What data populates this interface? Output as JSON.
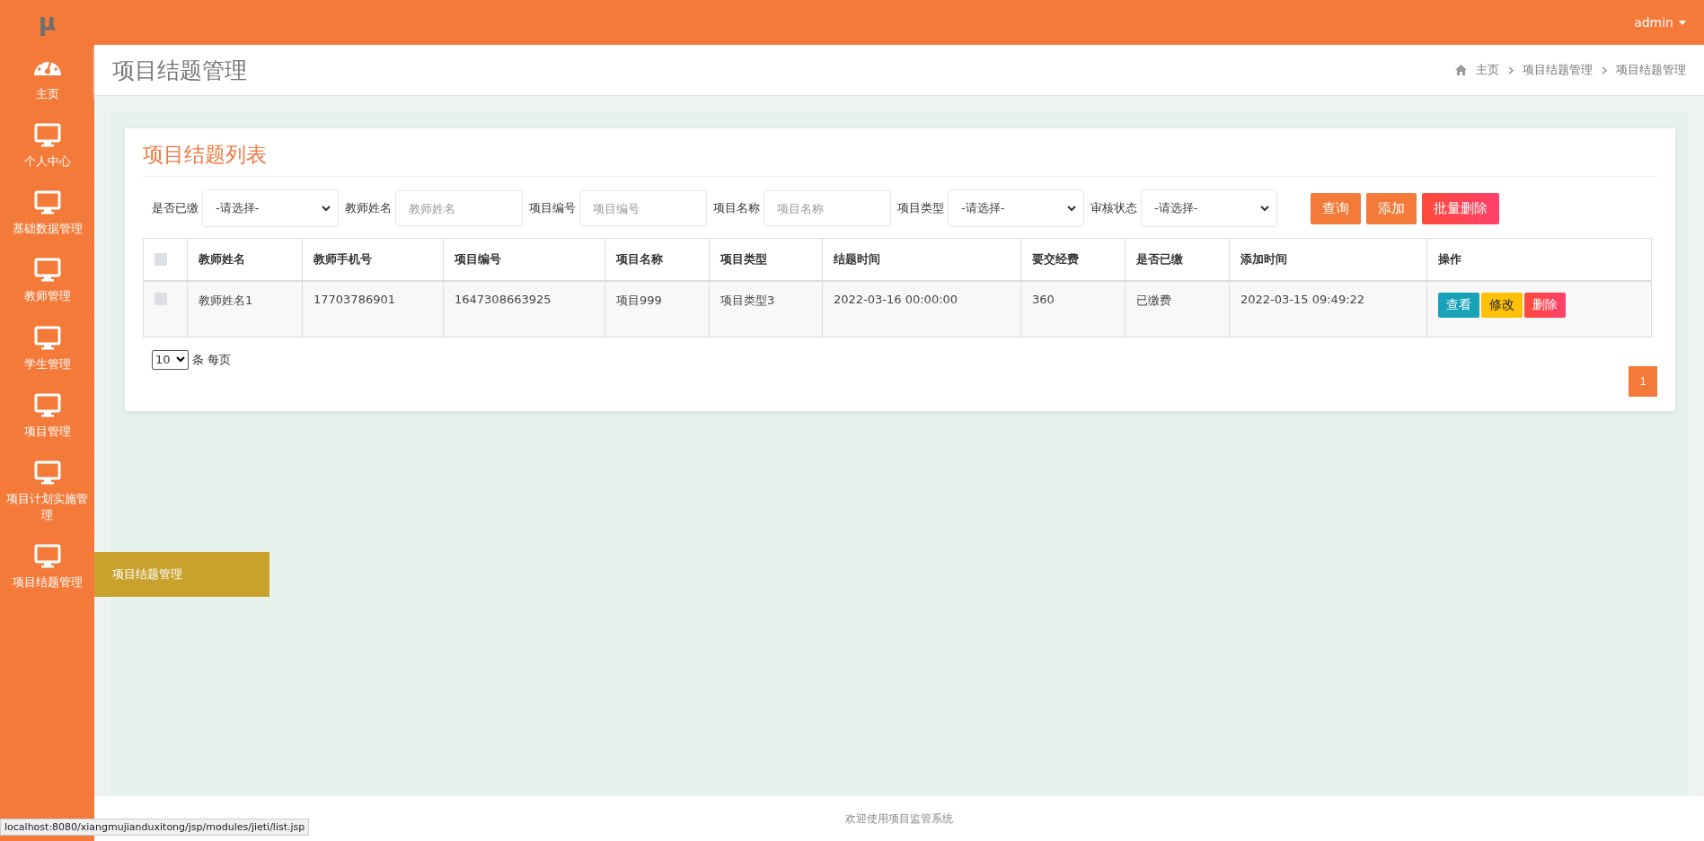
{
  "topbar": {
    "logo": "μ",
    "user": "admin"
  },
  "sidebar": {
    "items": [
      {
        "label": "主页",
        "kind": "gauge"
      },
      {
        "label": "个人中心",
        "kind": "monitor"
      },
      {
        "label": "基础数据管理",
        "kind": "monitor"
      },
      {
        "label": "教师管理",
        "kind": "monitor"
      },
      {
        "label": "学生管理",
        "kind": "monitor"
      },
      {
        "label": "项目管理",
        "kind": "monitor"
      },
      {
        "label": "项目计划实施管理",
        "kind": "monitor"
      },
      {
        "label": "项目结题管理",
        "kind": "monitor",
        "submenu": [
          "项目结题管理"
        ]
      }
    ]
  },
  "header": {
    "title": "项目结题管理",
    "breadcrumb": [
      "主页",
      "项目结题管理",
      "项目结题管理"
    ]
  },
  "card": {
    "title": "项目结题列表",
    "filters": [
      {
        "label": "是否已缴",
        "kind": "select",
        "value": "-请选择-"
      },
      {
        "label": "教师姓名",
        "kind": "input",
        "placeholder": "教师姓名"
      },
      {
        "label": "项目编号",
        "kind": "input",
        "placeholder": "项目编号"
      },
      {
        "label": "项目名称",
        "kind": "input",
        "placeholder": "项目名称"
      },
      {
        "label": "项目类型",
        "kind": "select",
        "value": "-请选择-"
      },
      {
        "label": "审核状态",
        "kind": "select",
        "value": "-请选择-"
      }
    ],
    "buttons": [
      {
        "label": "查询",
        "kind": "primary"
      },
      {
        "label": "添加",
        "kind": "primary"
      },
      {
        "label": "批量删除",
        "kind": "danger"
      }
    ],
    "table": {
      "all_checked": false,
      "columns": [
        "教师姓名",
        "教师手机号",
        "项目编号",
        "项目名称",
        "项目类型",
        "结题时间",
        "要交经费",
        "是否已缴",
        "添加时间",
        "操作"
      ],
      "rows": [
        {
          "checked": false,
          "cells": [
            "教师姓名1",
            "17703786901",
            "1647308663925",
            "项目999",
            "项目类型3",
            "2022-03-16 00:00:00",
            "360",
            "已缴费",
            "2022-03-15 09:49:22"
          ],
          "actions": [
            {
              "label": "查看",
              "kind": "info"
            },
            {
              "label": "修改",
              "kind": "warning"
            },
            {
              "label": "删除",
              "kind": "danger"
            }
          ]
        }
      ]
    },
    "page_size": {
      "value": "10",
      "label": "条 每页"
    },
    "pagination": [
      {
        "label": "1",
        "selected": true
      }
    ]
  },
  "footer": "欢迎使用项目监管系统",
  "status_url": "localhost:8080/xiangmujianduxitong/jsp/modules/jieti/list.jsp"
}
